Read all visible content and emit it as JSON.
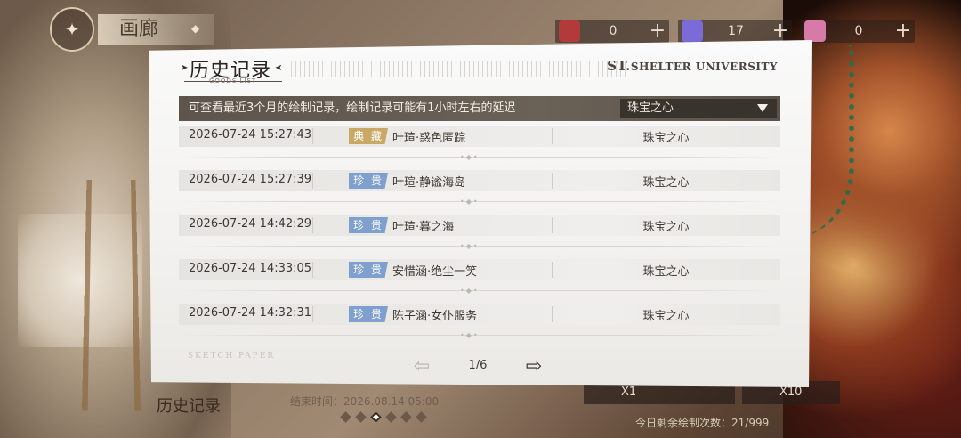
{
  "top_bar": {
    "title": "画廊",
    "currencies": [
      {
        "icon": "crown-ticket-icon",
        "value": "0",
        "color": "#b23a3a"
      },
      {
        "icon": "diamond-icon",
        "value": "17",
        "color": "#7a6bd6"
      },
      {
        "icon": "pink-gem-icon",
        "value": "0",
        "color": "#d87aa8"
      }
    ],
    "add_label": "+"
  },
  "background": {
    "history_label": "历史记录",
    "end_time": "结束时间：2026.08.14  05:00",
    "draw_x1": "X1",
    "draw_x10": "X10",
    "remaining": "今日剩余绘制次数：21/999",
    "page_dots": 6,
    "active_dot": 2
  },
  "modal": {
    "title": "历史记录",
    "subtitle": "GOODS LIST",
    "brand_prefix": "ST.",
    "brand_rest": "SHELTER UNIVERSITY",
    "notice": "可查看最近3个月的绘制记录，绘制记录可能有1小时左右的延迟",
    "filter_value": "珠宝之心",
    "watermark": "SKETCH PAPER",
    "page_indicator": "1/6",
    "records": [
      {
        "time": "2026-07-24  15:27:43",
        "rarity": "典 藏",
        "rarity_color": "#c9a865",
        "item": "叶瑄·惑色匿踪",
        "pool": "珠宝之心"
      },
      {
        "time": "2026-07-24  15:27:39",
        "rarity": "珍 贵",
        "rarity_color": "#7fa0cf",
        "item": "叶瑄·静谧海岛",
        "pool": "珠宝之心"
      },
      {
        "time": "2026-07-24  14:42:29",
        "rarity": "珍 贵",
        "rarity_color": "#7fa0cf",
        "item": "叶瑄·暮之海",
        "pool": "珠宝之心"
      },
      {
        "time": "2026-07-24  14:33:05",
        "rarity": "珍 贵",
        "rarity_color": "#7fa0cf",
        "item": "安惜涵·绝尘一笑",
        "pool": "珠宝之心"
      },
      {
        "time": "2026-07-24  14:32:31",
        "rarity": "珍 贵",
        "rarity_color": "#7fa0cf",
        "item": "陈子涵·女仆服务",
        "pool": "珠宝之心"
      }
    ]
  }
}
